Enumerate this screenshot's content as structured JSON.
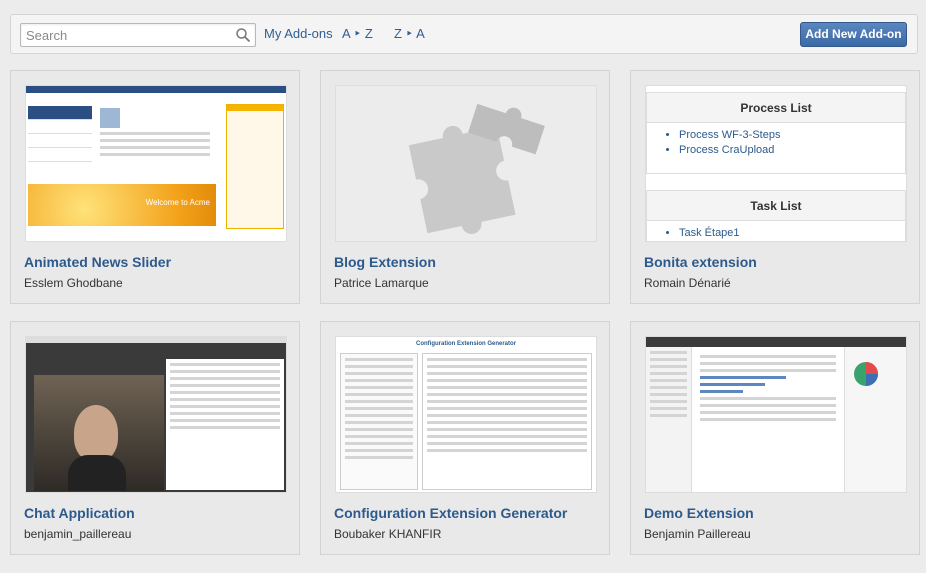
{
  "toolbar": {
    "search_placeholder": "Search",
    "my_addons": "My Add-ons",
    "sort_az": "A ‣ Z",
    "sort_za": "Z ‣ A",
    "add_button": "Add New Add-on"
  },
  "accent_color": "#2d5a8c",
  "button_color": "#4a78b4",
  "cards": [
    {
      "title": "Animated News Slider",
      "author": "Esslem Ghodbane",
      "thumb": "news-slider"
    },
    {
      "title": "Blog Extension",
      "author": "Patrice Lamarque",
      "thumb": "puzzle"
    },
    {
      "title": "Bonita extension",
      "author": "Romain Dénarié",
      "thumb": "bonita"
    },
    {
      "title": "Chat Application",
      "author": "benjamin_paillereau",
      "thumb": "chat"
    },
    {
      "title": "Configuration Extension Generator",
      "author": "Boubaker KHANFIR",
      "thumb": "config"
    },
    {
      "title": "Demo Extension",
      "author": "Benjamin Paillereau",
      "thumb": "demo"
    }
  ],
  "thumbs": {
    "news_banner": "Welcome to Acme",
    "bonita_process_header": "Process List",
    "bonita_processes": [
      "Process WF-3-Steps",
      "Process CraUpload"
    ],
    "bonita_task_header": "Task List",
    "bonita_task": "Task Étape1",
    "config_title": "Configuration Extension Generator"
  }
}
